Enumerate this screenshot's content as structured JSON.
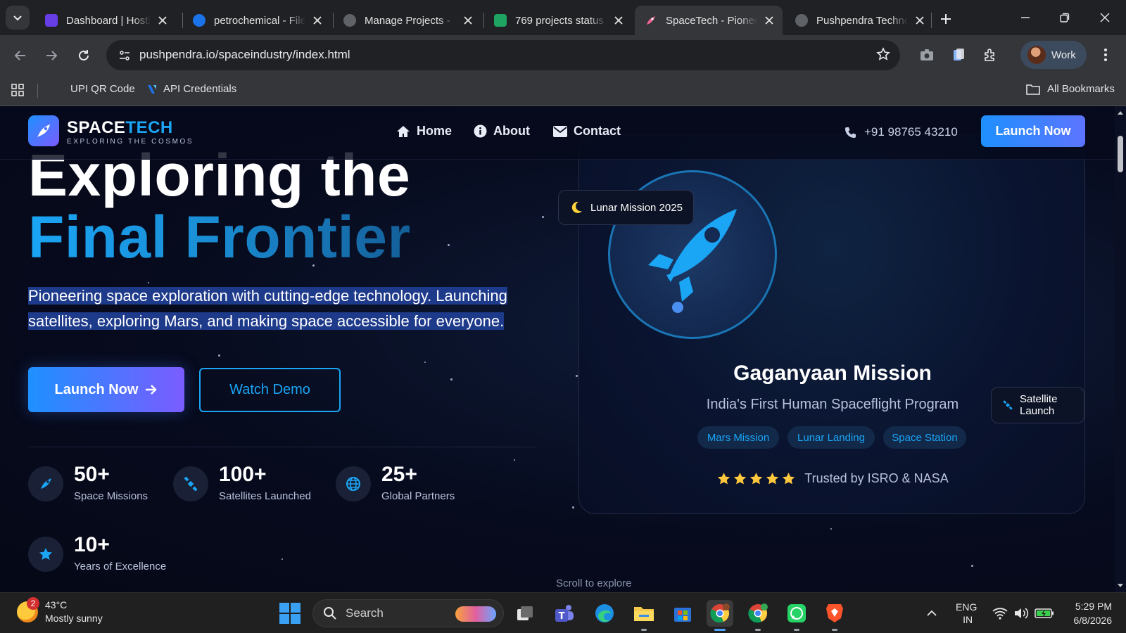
{
  "browser": {
    "tabs": [
      {
        "label": "Dashboard | Hostinger",
        "active": false
      },
      {
        "label": "petrochemical - Files",
        "active": false
      },
      {
        "label": "Manage Projects - ",
        "active": false
      },
      {
        "label": "769 projects status",
        "active": false
      },
      {
        "label": "SpaceTech - Pioneer",
        "active": true
      },
      {
        "label": "Pushpendra Technologies",
        "active": false
      }
    ],
    "url": "pushpendra.io/spaceindustry/index.html",
    "profile": "Work",
    "bookmarks": [
      {
        "label": "UPI QR Code"
      },
      {
        "label": "API Credentials"
      }
    ],
    "all_bookmarks": "All Bookmarks"
  },
  "site": {
    "logo_main_a": "SPACE",
    "logo_main_b": "TECH",
    "logo_sub": "EXPLORING THE COSMOS",
    "nav": [
      {
        "label": "Home",
        "icon": "home-icon"
      },
      {
        "label": "About",
        "icon": "info-icon"
      },
      {
        "label": "Contact",
        "icon": "envelope-icon"
      }
    ],
    "phone": "+91 98765 43210",
    "nav_cta": "Launch Now",
    "accent": "#1aa5f5"
  },
  "hero": {
    "title_line1": "Exploring the",
    "title_line2": "Final Frontier",
    "description": "Pioneering space exploration with cutting-edge technology. Launching satellites, exploring Mars, and making space accessible for everyone.",
    "primary_cta": "Launch Now",
    "secondary_cta": "Watch Demo",
    "stats": [
      {
        "value": "50+",
        "label": "Space Missions",
        "icon": "rocket-icon"
      },
      {
        "value": "100+",
        "label": "Satellites Launched",
        "icon": "satellite-icon"
      },
      {
        "value": "25+",
        "label": "Global Partners",
        "icon": "globe-icon"
      },
      {
        "value": "10+",
        "label": "Years of Excellence",
        "icon": "star-icon"
      }
    ],
    "scroll_hint": "Scroll to explore"
  },
  "mission_card": {
    "badge_top": "Lunar Mission 2025",
    "badge_right": "Satellite Launch",
    "title": "Gaganyaan Mission",
    "subtitle": "India's First Human Spaceflight Program",
    "tags": [
      "Mars Mission",
      "Lunar Landing",
      "Space Station"
    ],
    "rating_stars": 5,
    "rating_text": "Trusted by ISRO & NASA"
  },
  "taskbar": {
    "weather_temp": "43°C",
    "weather_desc": "Mostly sunny",
    "weather_badge": "2",
    "search_label": "Search",
    "lang_line1": "ENG",
    "lang_line2": "IN",
    "time": "5:29 PM",
    "date": "6/8/2026"
  }
}
